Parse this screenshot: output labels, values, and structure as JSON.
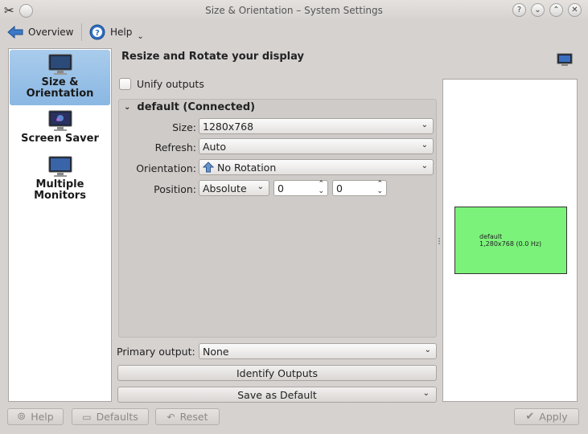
{
  "window": {
    "title": "Size & Orientation – System Settings"
  },
  "toolbar": {
    "overview_label": "Overview",
    "help_label": "Help"
  },
  "sidebar": {
    "items": [
      {
        "label_line1": "Size &",
        "label_line2": "Orientation",
        "active": true
      },
      {
        "label_line1": "Screen Saver",
        "label_line2": "",
        "active": false
      },
      {
        "label_line1": "Multiple",
        "label_line2": "Monitors",
        "active": false
      }
    ]
  },
  "page": {
    "title": "Resize and Rotate your display"
  },
  "unify": {
    "label": "Unify outputs",
    "checked": false
  },
  "output_group": {
    "title": "default (Connected)",
    "size_label": "Size:",
    "size_value": "1280x768",
    "refresh_label": "Refresh:",
    "refresh_value": "Auto",
    "orientation_label": "Orientation:",
    "orientation_value": "No Rotation",
    "position_label": "Position:",
    "position_mode": "Absolute",
    "position_x": "0",
    "position_y": "0"
  },
  "primary": {
    "label": "Primary output:",
    "value": "None"
  },
  "buttons": {
    "identify": "Identify Outputs",
    "save_default": "Save as Default",
    "help": "Help",
    "defaults": "Defaults",
    "reset": "Reset",
    "apply": "Apply"
  },
  "preview": {
    "output_name": "default",
    "output_info": "1,280x768 (0.0 Hz)",
    "screen_color": "#7bf27a"
  },
  "icons": {
    "app": "tools-icon",
    "back": "arrow-left-icon",
    "help": "help-icon",
    "monitor": "monitor-icon"
  }
}
